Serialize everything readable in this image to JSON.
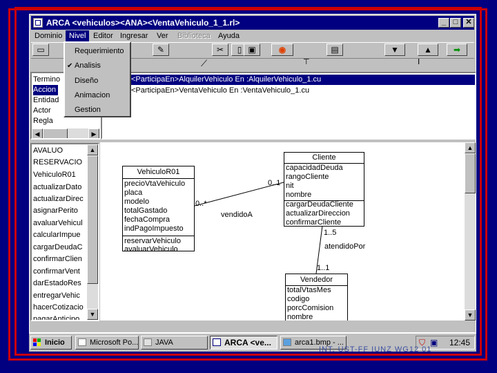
{
  "window": {
    "title": "ARCA <vehiculos><ANA><VentaVehiculo_1_1.rl>"
  },
  "titlebar_buttons": {
    "minimize": "_",
    "maximize": "□",
    "close": "✕"
  },
  "menubar": [
    "Dominio",
    "Nivel",
    "Editor",
    "Ingresar",
    "Ver",
    "Biblioteca",
    "Ayuda"
  ],
  "nivel_menu": {
    "items": [
      "Requerimiento",
      "Analisis",
      "Diseño",
      "Animacion",
      "Gestion"
    ],
    "checked": "Analisis"
  },
  "type_list": [
    "Termino",
    "Accion",
    "Entidad",
    "Actor",
    "Regla"
  ],
  "type_list_selected": "Accion",
  "relations": [
    "<ParticipaEn>AlquilerVehiculo En :AlquilerVehiculo_1.cu",
    "<ParticipaEn>VentaVehiculo En :VentaVehiculo_1.cu"
  ],
  "element_list": [
    "AVALUO",
    "RESERVACIO",
    "VehiculoR01",
    "actualizarDato",
    "actualizarDirec",
    "asignarPerito",
    "avaluarVehicul",
    "calcularImpue",
    "cargarDeudaC",
    "confirmarClien",
    "confirmarVent",
    "darEstadoRes",
    "entregarVehic",
    "hacerCotizacio",
    "pagarAnticipo"
  ],
  "diagram": {
    "classes": {
      "vehiculo": {
        "name": "VehiculoR01",
        "attributes": [
          "precioVtaVehiculo",
          "placa",
          "modelo",
          "totalGastado",
          "fechaCompra",
          "indPagoImpuesto"
        ],
        "methods": [
          "reservarVehiculo",
          "avaluarVehiculo"
        ]
      },
      "cliente": {
        "name": "Cliente",
        "attributes": [
          "capacidadDeuda",
          "rangoCliente",
          "nit",
          "nombre"
        ],
        "methods": [
          "cargarDeudaCliente",
          "actualizarDireccion",
          "confirmarCliente"
        ]
      },
      "vendedor": {
        "name": "Vendedor",
        "attributes": [
          "totalVtasMes",
          "codigo",
          "porcComision",
          "nombre"
        ],
        "methods": []
      }
    },
    "associations": [
      {
        "name": "vendidoA",
        "from_mult": "0..*",
        "to_mult": "0..1"
      },
      {
        "name": "atendidoPor",
        "from_mult": "1..5",
        "to_mult": "1..1"
      }
    ]
  },
  "taskbar": {
    "start": "Inicio",
    "tasks": [
      "Microsoft Po...",
      "JAVA",
      "ARCA <ve...",
      "arca1.bmp - ..."
    ],
    "active_task": "ARCA <ve...",
    "clock": "12:45"
  },
  "footer": "INT. UST-FF IUNZ WG12 01",
  "colors": {
    "accent": "#000080",
    "frame": "#cc0000",
    "chrome": "#c0c0c0"
  }
}
